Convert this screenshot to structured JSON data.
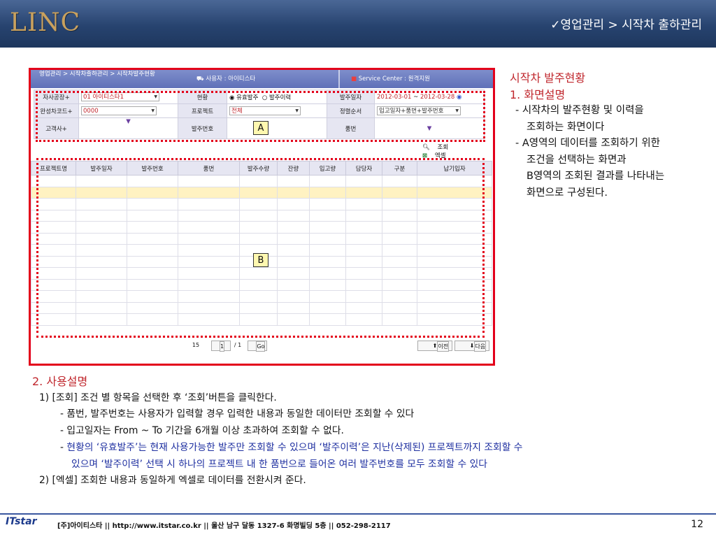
{
  "header": {
    "logo": "LINC",
    "breadcrumb": "✓영업관리 > 시작차 출하관리"
  },
  "app": {
    "nav": "영업관리 > 시작차출하관리 > 시작차발주현황",
    "user": "사용자 : 아이티스타",
    "service": "Service Center : 원격지원",
    "filters": {
      "company_label": "자사공장+",
      "company_value": "01 아이티스타1",
      "status_label": "현황",
      "status_opt1": "유효발주",
      "status_opt2": "발주이력",
      "order_date_label": "발주일자",
      "date_from": "2012-03-01",
      "date_sep": "~",
      "date_to": "2012-03-28",
      "car_code_label": "완성차코드+",
      "car_code_value": "0000",
      "project_label": "프로젝트",
      "project_value": "전체",
      "sort_label": "정렬순서",
      "sort_value": "입고일자+품번+발주번호",
      "customer_label": "고객사+",
      "order_no_label": "발주번호",
      "part_no_label": "품번"
    },
    "buttons": {
      "search": "조회",
      "excel": "엑셀"
    },
    "grid_columns": [
      "프로젝트명",
      "발주일자",
      "발주번호",
      "품번",
      "발주수량",
      "잔량",
      "입고량",
      "담당자",
      "구분",
      "납기입자"
    ],
    "pager": {
      "page_size": "15",
      "page": "1",
      "total": "/ 1",
      "go": "Go",
      "prev": "이전",
      "next": "다음"
    },
    "box_a": "A",
    "box_b": "B"
  },
  "right": {
    "title": "시작차 발주현황",
    "section1": "1. 화면설명",
    "lines": [
      "- 시작차의 발주현황 및 이력을",
      "조회하는 화면이다",
      "- A영역의 데이터를 조회하기 위한",
      "조건을 선택하는 화면과",
      "B영역의 조회된 결과를 나타내는",
      "화면으로 구성된다."
    ]
  },
  "bottom": {
    "title": "2. 사용설명",
    "l1": "1) [조회] 조건 별 항목을 선택한 후 ‘조회’버튼을 클릭한다.",
    "l2": "- 품번, 발주번호는 사용자가 입력할 경우 입력한 내용과 동일한 데이터만 조회할 수 있다",
    "l3": "- 입고일자는 From ~ To 기간을 6개월 이상 초과하여 조회할 수 없다.",
    "l4a": "- ",
    "l4b": "현황의 ‘유효발주’는 현재 사용가능한 발주만 조회할 수 있으며 ‘발주이력’은 지난(삭제된) 프로젝트까지 조회할 수",
    "l5": "있으며 ‘발주이력’ 선택 시 하나의 프로젝트 내 한 품번으로 들어온 여러 발주번호를 모두 조회할 수 있다",
    "l6": "2) [엑셀] 조회한 내용과 동일하게 엑셀로 데이터를 전환시켜 준다."
  },
  "footer": {
    "logo": "ITstar",
    "address": "[주]아이티스타 || http://www.itstar.co.kr || 울산 남구 달동 1327-6 화명빌딩 5층 || 052-298-2117",
    "page": "12"
  }
}
